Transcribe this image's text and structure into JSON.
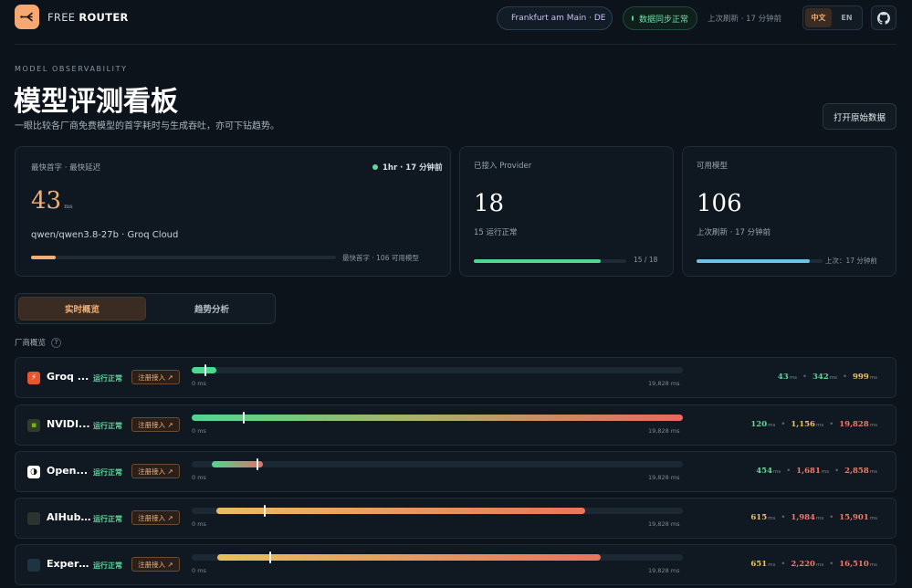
{
  "header": {
    "brand_light": "FREE",
    "brand_bold": "ROUTER",
    "location": "Frankfurt am Main · DE",
    "sync_status": "数据同步正常",
    "refresh": "上次刷新 · 17 分钟前",
    "lang_zh": "中文",
    "lang_en": "EN"
  },
  "hero": {
    "eyebrow": "MODEL OBSERVABILITY",
    "title": "模型评测看板",
    "subtitle": "一眼比较各厂商免费模型的首字耗时与生成吞吐，亦可下钻趋势。",
    "raw_button": "打开原始数据"
  },
  "stats": {
    "fastest": {
      "label": "最快首字 · 最快延迟",
      "badge": "1hr · 17 分钟前",
      "value": "43",
      "unit": "ms",
      "model": "qwen/qwen3.8-27b · Groq Cloud",
      "footer_left": "最快首字",
      "footer_right": "106 可用模型",
      "progress": 0.08
    },
    "providers": {
      "label": "已接入 Provider",
      "value": "18",
      "sub": "15 运行正常",
      "footer": "15 / 18",
      "progress": 0.833
    },
    "models": {
      "label": "可用模型",
      "value": "106",
      "sub": "上次刷新 · 17 分钟前",
      "footer": "上次：17 分钟前",
      "progress": 0.9
    }
  },
  "tabs": {
    "live": "实时概览",
    "trend": "趋势分析"
  },
  "section_title": "厂商概览",
  "section_help": "?",
  "scale": {
    "min": "0 ms",
    "max": "19,828 ms",
    "max_value": 19828
  },
  "providers": [
    {
      "name": "Groq ...",
      "status": "运行正常",
      "tag": "注册接入 ↗",
      "icon": "⚡",
      "icon_bg": "#e8562e",
      "icon_fg": "#ffffff",
      "min": 43,
      "median": 342,
      "max": 999,
      "min_label": "43",
      "median_label": "342",
      "max_label": "999",
      "colors": [
        "green",
        "green",
        "orange"
      ]
    },
    {
      "name": "NVIDI...",
      "status": "运行正常",
      "tag": "注册接入 ↗",
      "icon": "▪",
      "icon_bg": "#2f3d2a",
      "icon_fg": "#76b900",
      "min": 120,
      "median": 1156,
      "max": 19828,
      "min_label": "120",
      "median_label": "1,156",
      "max_label": "19,828",
      "colors": [
        "green",
        "orange",
        "red"
      ]
    },
    {
      "name": "Open...",
      "status": "运行正常",
      "tag": "注册接入 ↗",
      "icon": "◑",
      "icon_bg": "#ffffff",
      "icon_fg": "#111111",
      "min": 454,
      "median": 1681,
      "max": 2858,
      "min_label": "454",
      "median_label": "1,681",
      "max_label": "2,858",
      "colors": [
        "green",
        "red",
        "red"
      ]
    },
    {
      "name": "AIHub...",
      "status": "运行正常",
      "tag": "注册接入 ↗",
      "icon": "",
      "icon_bg": "#2b3430",
      "icon_fg": "#9fb0a6",
      "min": 615,
      "median": 1984,
      "max": 15901,
      "min_label": "615",
      "median_label": "1,984",
      "max_label": "15,901",
      "colors": [
        "orange",
        "red",
        "red"
      ]
    },
    {
      "name": "Experi...",
      "status": "运行正常",
      "tag": "注册接入 ↗",
      "icon": "",
      "icon_bg": "#1f3442",
      "icon_fg": "#8fb6c8",
      "min": 651,
      "median": 2220,
      "max": 16510,
      "min_label": "651",
      "median_label": "2,220",
      "max_label": "16,510",
      "colors": [
        "orange",
        "red",
        "red"
      ]
    }
  ],
  "colors": {
    "accent": "#f4ae73",
    "ok_green": "#5fd89b",
    "warn_yellow": "#f2c25a",
    "bad_red": "#f07a6a",
    "providers_bar": "#4fd68f",
    "models_bar": "#6cc4e0"
  }
}
